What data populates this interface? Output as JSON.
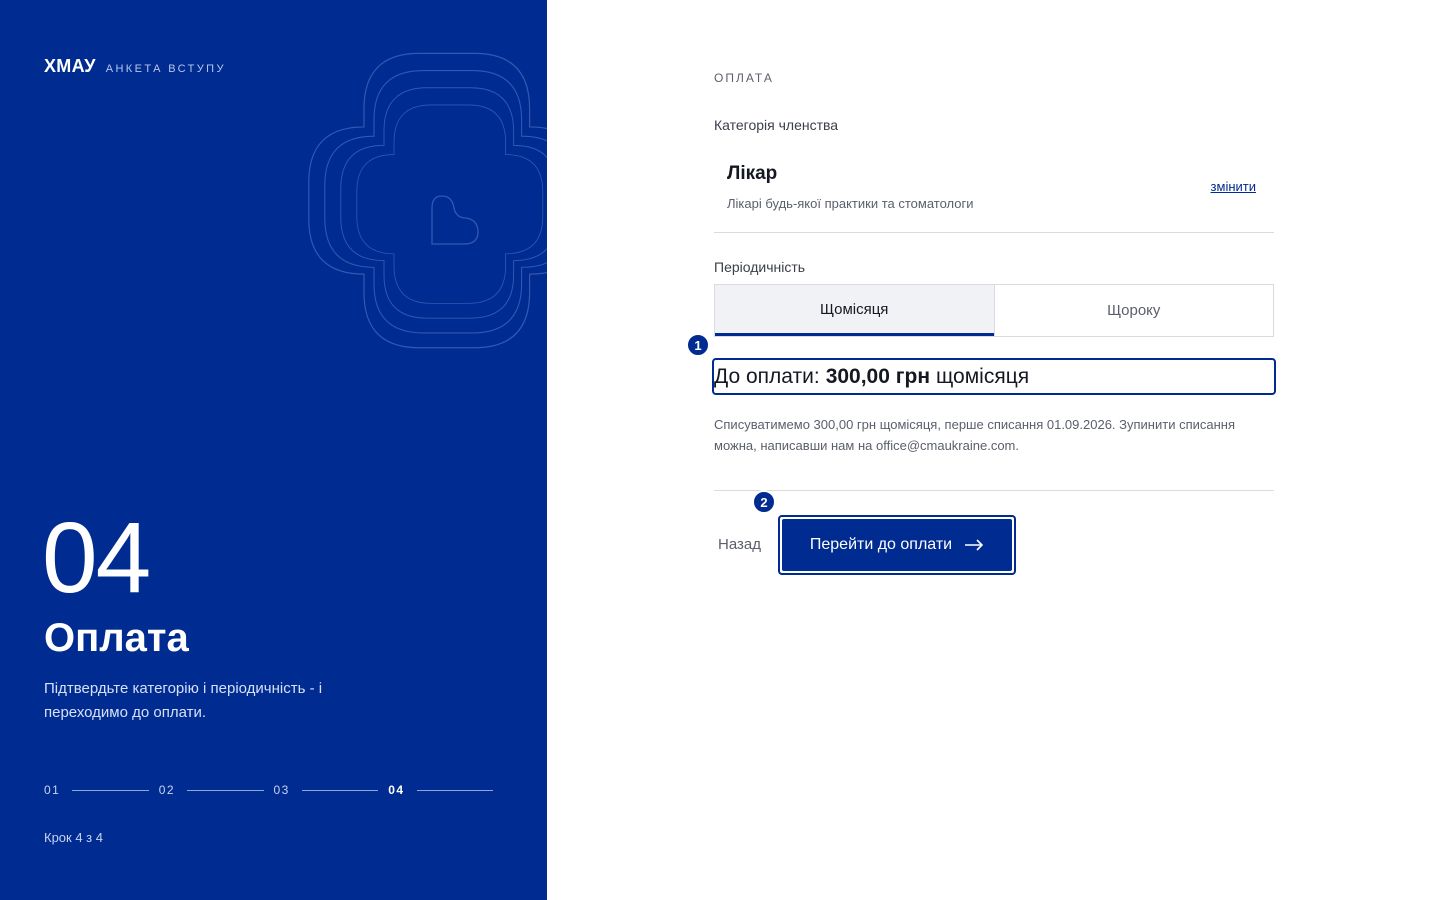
{
  "brand": {
    "name": "ХМАУ",
    "subtitle": "АНКЕТА ВСТУПУ"
  },
  "step": {
    "number": "04",
    "title": "Оплата",
    "description": "Підтвердьте категорію і періодичність - і переходимо до оплати.",
    "progress": [
      "01",
      "02",
      "03",
      "04"
    ],
    "current_index": 4,
    "caption": "Крок 4 з 4"
  },
  "form": {
    "section_kicker": "ОПЛАТА",
    "category_label": "Категорія членства",
    "category": {
      "name": "Лікар",
      "description": "Лікарі будь-якої практики та стоматологи",
      "change_label": "змінити"
    },
    "periodicity_label": "Періодичність",
    "periodicity_options": [
      {
        "label": "Щомісяця",
        "selected": true
      },
      {
        "label": "Щороку",
        "selected": false
      }
    ],
    "total": {
      "prefix": "До оплати:",
      "amount": "300,00 грн",
      "suffix": "щомісяця"
    },
    "note": "Списуватимемо 300,00 грн щомісяця, перше списання 01.09.2026. Зупинити списання можна, написавши нам на office@cmaukraine.com.",
    "back_label": "Назад",
    "submit_label": "Перейти до оплати",
    "markers": [
      "1",
      "2"
    ]
  },
  "colors": {
    "brand_blue": "#002b91",
    "border": "#d9dbe1",
    "muted_text": "#5a5f6b"
  },
  "icons": {
    "submit": "arrow-right-icon",
    "emblem": "cross-heart-emblem-icon"
  }
}
